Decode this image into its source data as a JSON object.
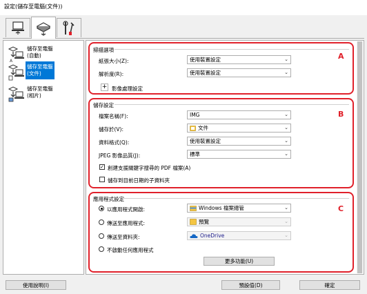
{
  "window": {
    "title": "設定(儲存至電腦(文件))"
  },
  "tabs": [
    {
      "name": "scan-from-operation-panel"
    },
    {
      "name": "scan-from-computer"
    },
    {
      "name": "general-settings"
    }
  ],
  "sidebar": {
    "items": [
      {
        "label_line1": "儲存至電腦",
        "label_line2": "(自動)",
        "selected": false
      },
      {
        "label_line1": "儲存至電腦",
        "label_line2": "(文件)",
        "selected": true
      },
      {
        "label_line1": "儲存至電腦",
        "label_line2": "(相片)",
        "selected": false
      }
    ]
  },
  "section_a": {
    "title": "掃描選項",
    "letter": "A",
    "paper_size_label": "紙張大小(Z):",
    "paper_size_value": "使用裝置設定",
    "resolution_label": "解析度(R):",
    "resolution_value": "使用裝置設定",
    "image_processing_label": "影像處理設定"
  },
  "section_b": {
    "title": "儲存設定",
    "letter": "B",
    "file_name_label": "檔案名稱(F):",
    "file_name_value": "IMG",
    "save_in_label": "儲存於(V):",
    "save_in_value": "文件",
    "data_format_label": "資料格式(Q):",
    "data_format_value": "使用裝置設定",
    "jpeg_quality_label": "JPEG 影像品質(J):",
    "jpeg_quality_value": "標準",
    "pdf_keyword_label": "創建支援關鍵字搜尋的 PDF 檔案(A)",
    "pdf_keyword_checked": true,
    "subfolder_label": "儲存到目前日期的子資料夾",
    "subfolder_checked": false
  },
  "section_c": {
    "title": "應用程式設定",
    "letter": "C",
    "open_app_label": "以應用程式開啟:",
    "open_app_value": "Windows 檔案總管",
    "send_app_label": "傳送至應用程式:",
    "send_app_value": "預覽",
    "send_folder_label": "傳送至資料夾:",
    "send_folder_value": "OneDrive",
    "no_app_label": "不啟動任何應用程式",
    "more_functions_label": "更多功能(U)",
    "selected_option": "open_app"
  },
  "footer": {
    "help_label": "使用說明(I)",
    "defaults_label": "預設值(D)",
    "ok_label": "確定"
  },
  "colors": {
    "highlight": "#e0202a",
    "selection": "#0078d7"
  }
}
